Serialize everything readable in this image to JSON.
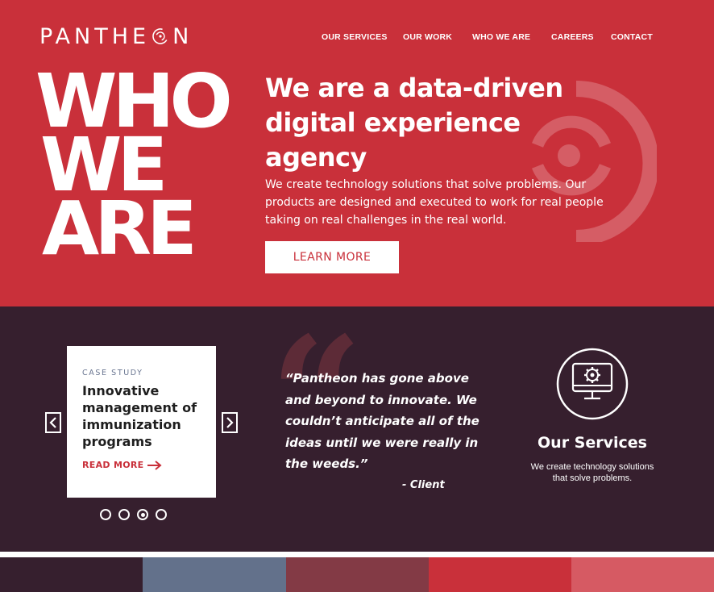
{
  "brand": {
    "logo_before": "PANTHE",
    "logo_after": "N"
  },
  "nav": [
    {
      "label": "OUR SERVICES"
    },
    {
      "label": "OUR WORK"
    },
    {
      "label": "WHO WE ARE"
    },
    {
      "label": "CAREERS"
    },
    {
      "label": "CONTACT"
    }
  ],
  "hero": {
    "big_words": [
      "WHO",
      "WE",
      "ARE"
    ],
    "headline": "We are a data-driven digital experience agency",
    "description": "We create technology solutions that solve problems.  Our products are designed and executed to work for real people taking on real challenges in the real world.",
    "cta_label": "LEARN MORE"
  },
  "case_study": {
    "kicker": "CASE STUDY",
    "title": "Innovative management of immunization programs",
    "read_more": "READ MORE",
    "slide_count": 4,
    "active_slide": 3
  },
  "testimonial": {
    "quote_glyph": "“",
    "quote": "“Pantheon has gone above and beyond to innovate. We couldn’t anticipate all of the ideas until we were really in the weeds.”",
    "attribution": "- Client"
  },
  "services": {
    "title": "Our Services",
    "description": "We create technology solutions that solve problems.",
    "icon": "monitor-gear-icon"
  },
  "colors": {
    "brand_red": "#c9303a",
    "dark_plum": "#361f2e",
    "quote_mark": "#5d2b37",
    "slate_blue": "#6a7691"
  },
  "palette": [
    "#361f2e",
    "#63718b",
    "#833a45",
    "#c9303a",
    "#d65a63"
  ]
}
